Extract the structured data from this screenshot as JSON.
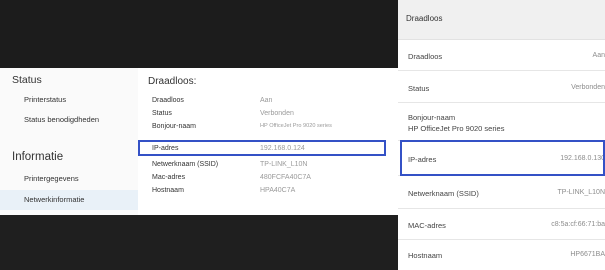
{
  "left": {
    "sidebar": {
      "groups": [
        {
          "title": "Status",
          "items": [
            "Printerstatus",
            "Status benodigdheden"
          ]
        },
        {
          "title": "Informatie",
          "items": [
            "Printergegevens",
            "Netwerkinformatie"
          ]
        }
      ],
      "active_item": "Netwerkinformatie"
    },
    "main": {
      "title": "Draadloos:",
      "rows": [
        {
          "label": "Draadloos",
          "value": "Aan"
        },
        {
          "label": "Status",
          "value": "Verbonden"
        },
        {
          "label": "Bonjour-naam",
          "value": "HP OfficeJet Pro 9020 series"
        },
        {
          "label": "IP-adres",
          "value": "192.168.0.124"
        },
        {
          "label": "Netwerknaam (SSID)",
          "value": "TP-LINK_L10N"
        },
        {
          "label": "Mac-adres",
          "value": "480FCFA40C7A"
        },
        {
          "label": "Hostnaam",
          "value": "HPA40C7A"
        }
      ],
      "highlighted_row": "IP-adres",
      "highlight_color": "#3451c6"
    }
  },
  "right": {
    "header": "Draadloos",
    "rows": [
      {
        "label": "Draadloos",
        "value": "Aan"
      },
      {
        "label": "Status",
        "value": "Verbonden"
      },
      {
        "label": "Bonjour-naam",
        "sub": "HP OfficeJet Pro 9020 series"
      },
      {
        "label": "IP-adres",
        "value": "192.168.0.130"
      },
      {
        "label": "Netwerknaam (SSID)",
        "value": "TP-LINK_L10N"
      },
      {
        "label": "MAC-adres",
        "value": "c8:5a:cf:66:71:ba"
      },
      {
        "label": "Hostnaam",
        "value": "HP6671BA"
      }
    ],
    "highlighted_row": "IP-adres"
  }
}
